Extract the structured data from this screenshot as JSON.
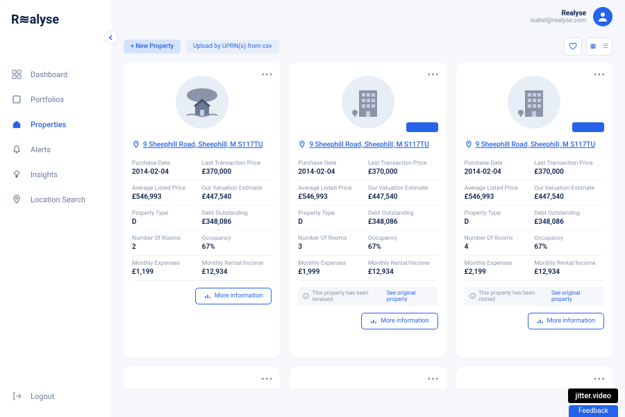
{
  "brand": "Realyse",
  "user": {
    "name": "Realyse",
    "email": "isabel@realyse.com"
  },
  "nav": [
    {
      "label": "Dashboard",
      "icon": "grid"
    },
    {
      "label": "Portfolios",
      "icon": "square"
    },
    {
      "label": "Properties",
      "icon": "home",
      "active": true
    },
    {
      "label": "Alerts",
      "icon": "bell"
    },
    {
      "label": "Insights",
      "icon": "bulb"
    },
    {
      "label": "Location Search",
      "icon": "pin"
    }
  ],
  "logout": "Logout",
  "toolbar": {
    "new_property": "+ New Property",
    "upload": "Upload by UPRN(s) from csv"
  },
  "labels": {
    "purchase_date": "Purchase Date",
    "last_transaction": "Last Transaction Price",
    "avg_listed": "Average Listed Price",
    "valuation": "Our Valuation Estimate",
    "property_type": "Property Type",
    "debt": "Debt Outstanding",
    "rooms": "Number Of Rooms",
    "occupancy": "Occupancy",
    "expenses": "Monthly Expenses",
    "rental": "Monthly Rental/Income",
    "more_info": "More information",
    "see_original": "See original property"
  },
  "cards": [
    {
      "address": "9 Sheephill Road, Sheephill, M S117TU",
      "img": "house",
      "badge": false,
      "purchase_date": "2014-02-04",
      "last_transaction": "£370,000",
      "avg_listed": "£546,993",
      "valuation": "£447,540",
      "property_type": "D",
      "debt": "£348,086",
      "rooms": "2",
      "occupancy": "67%",
      "expenses": "£1,199",
      "rental": "£12,934",
      "notice": null
    },
    {
      "address": "9 Sheephill Road, Sheephill, M S117TU",
      "img": "building",
      "badge": true,
      "purchase_date": "2014-02-04",
      "last_transaction": "£370,000",
      "avg_listed": "£546,993",
      "valuation": "£447,540",
      "property_type": "D",
      "debt": "£348,086",
      "rooms": "3",
      "occupancy": "67%",
      "expenses": "£1,999",
      "rental": "£12,934",
      "notice": "This property has been revalued"
    },
    {
      "address": "9 Sheephill Road, Sheephill, M S117TU",
      "img": "building",
      "badge": true,
      "purchase_date": "2014-02-04",
      "last_transaction": "£370,000",
      "avg_listed": "£546,993",
      "valuation": "£447,540",
      "property_type": "D",
      "debt": "£348,086",
      "rooms": "4",
      "occupancy": "67%",
      "expenses": "£2,199",
      "rental": "£12,934",
      "notice": "This property has been cloned"
    }
  ],
  "watermark": "jitter.video",
  "feedback": "Feedback"
}
